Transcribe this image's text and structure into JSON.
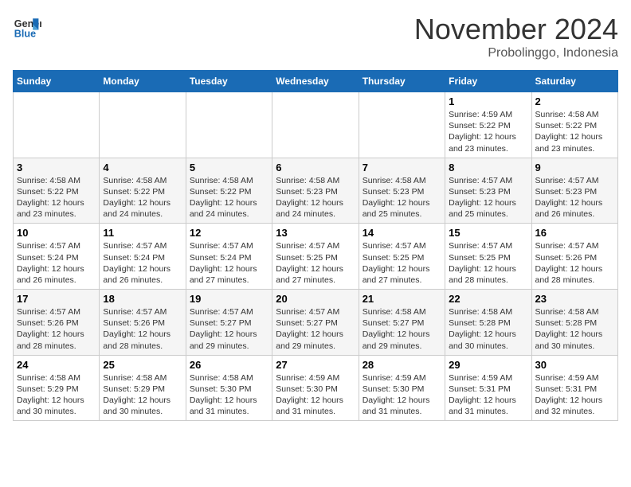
{
  "logo": {
    "line1": "General",
    "line2": "Blue"
  },
  "title": "November 2024",
  "subtitle": "Probolinggo, Indonesia",
  "weekdays": [
    "Sunday",
    "Monday",
    "Tuesday",
    "Wednesday",
    "Thursday",
    "Friday",
    "Saturday"
  ],
  "weeks": [
    [
      {
        "day": "",
        "info": ""
      },
      {
        "day": "",
        "info": ""
      },
      {
        "day": "",
        "info": ""
      },
      {
        "day": "",
        "info": ""
      },
      {
        "day": "",
        "info": ""
      },
      {
        "day": "1",
        "info": "Sunrise: 4:59 AM\nSunset: 5:22 PM\nDaylight: 12 hours and 23 minutes."
      },
      {
        "day": "2",
        "info": "Sunrise: 4:58 AM\nSunset: 5:22 PM\nDaylight: 12 hours and 23 minutes."
      }
    ],
    [
      {
        "day": "3",
        "info": "Sunrise: 4:58 AM\nSunset: 5:22 PM\nDaylight: 12 hours and 23 minutes."
      },
      {
        "day": "4",
        "info": "Sunrise: 4:58 AM\nSunset: 5:22 PM\nDaylight: 12 hours and 24 minutes."
      },
      {
        "day": "5",
        "info": "Sunrise: 4:58 AM\nSunset: 5:22 PM\nDaylight: 12 hours and 24 minutes."
      },
      {
        "day": "6",
        "info": "Sunrise: 4:58 AM\nSunset: 5:23 PM\nDaylight: 12 hours and 24 minutes."
      },
      {
        "day": "7",
        "info": "Sunrise: 4:58 AM\nSunset: 5:23 PM\nDaylight: 12 hours and 25 minutes."
      },
      {
        "day": "8",
        "info": "Sunrise: 4:57 AM\nSunset: 5:23 PM\nDaylight: 12 hours and 25 minutes."
      },
      {
        "day": "9",
        "info": "Sunrise: 4:57 AM\nSunset: 5:23 PM\nDaylight: 12 hours and 26 minutes."
      }
    ],
    [
      {
        "day": "10",
        "info": "Sunrise: 4:57 AM\nSunset: 5:24 PM\nDaylight: 12 hours and 26 minutes."
      },
      {
        "day": "11",
        "info": "Sunrise: 4:57 AM\nSunset: 5:24 PM\nDaylight: 12 hours and 26 minutes."
      },
      {
        "day": "12",
        "info": "Sunrise: 4:57 AM\nSunset: 5:24 PM\nDaylight: 12 hours and 27 minutes."
      },
      {
        "day": "13",
        "info": "Sunrise: 4:57 AM\nSunset: 5:25 PM\nDaylight: 12 hours and 27 minutes."
      },
      {
        "day": "14",
        "info": "Sunrise: 4:57 AM\nSunset: 5:25 PM\nDaylight: 12 hours and 27 minutes."
      },
      {
        "day": "15",
        "info": "Sunrise: 4:57 AM\nSunset: 5:25 PM\nDaylight: 12 hours and 28 minutes."
      },
      {
        "day": "16",
        "info": "Sunrise: 4:57 AM\nSunset: 5:26 PM\nDaylight: 12 hours and 28 minutes."
      }
    ],
    [
      {
        "day": "17",
        "info": "Sunrise: 4:57 AM\nSunset: 5:26 PM\nDaylight: 12 hours and 28 minutes."
      },
      {
        "day": "18",
        "info": "Sunrise: 4:57 AM\nSunset: 5:26 PM\nDaylight: 12 hours and 28 minutes."
      },
      {
        "day": "19",
        "info": "Sunrise: 4:57 AM\nSunset: 5:27 PM\nDaylight: 12 hours and 29 minutes."
      },
      {
        "day": "20",
        "info": "Sunrise: 4:57 AM\nSunset: 5:27 PM\nDaylight: 12 hours and 29 minutes."
      },
      {
        "day": "21",
        "info": "Sunrise: 4:58 AM\nSunset: 5:27 PM\nDaylight: 12 hours and 29 minutes."
      },
      {
        "day": "22",
        "info": "Sunrise: 4:58 AM\nSunset: 5:28 PM\nDaylight: 12 hours and 30 minutes."
      },
      {
        "day": "23",
        "info": "Sunrise: 4:58 AM\nSunset: 5:28 PM\nDaylight: 12 hours and 30 minutes."
      }
    ],
    [
      {
        "day": "24",
        "info": "Sunrise: 4:58 AM\nSunset: 5:29 PM\nDaylight: 12 hours and 30 minutes."
      },
      {
        "day": "25",
        "info": "Sunrise: 4:58 AM\nSunset: 5:29 PM\nDaylight: 12 hours and 30 minutes."
      },
      {
        "day": "26",
        "info": "Sunrise: 4:58 AM\nSunset: 5:30 PM\nDaylight: 12 hours and 31 minutes."
      },
      {
        "day": "27",
        "info": "Sunrise: 4:59 AM\nSunset: 5:30 PM\nDaylight: 12 hours and 31 minutes."
      },
      {
        "day": "28",
        "info": "Sunrise: 4:59 AM\nSunset: 5:30 PM\nDaylight: 12 hours and 31 minutes."
      },
      {
        "day": "29",
        "info": "Sunrise: 4:59 AM\nSunset: 5:31 PM\nDaylight: 12 hours and 31 minutes."
      },
      {
        "day": "30",
        "info": "Sunrise: 4:59 AM\nSunset: 5:31 PM\nDaylight: 12 hours and 32 minutes."
      }
    ]
  ]
}
